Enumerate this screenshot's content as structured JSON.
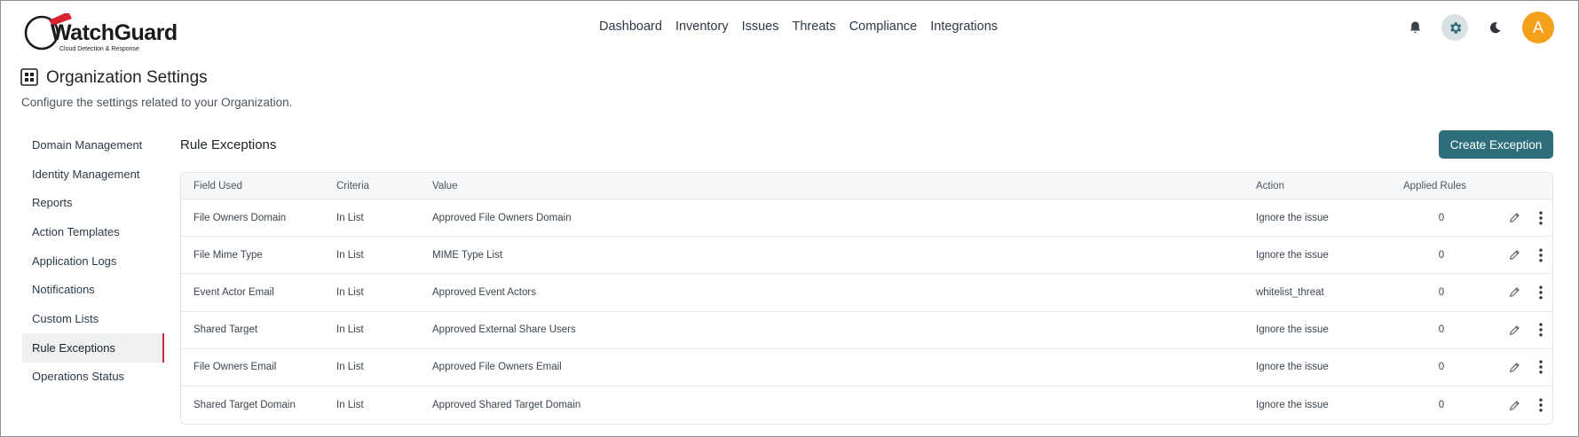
{
  "brand": {
    "name": "WatchGuard",
    "tagline": "Cloud Detection & Response"
  },
  "nav": {
    "items": [
      "Dashboard",
      "Inventory",
      "Issues",
      "Threats",
      "Compliance",
      "Integrations"
    ]
  },
  "header_icons": {
    "notifications": "bell-icon",
    "settings": "gear-icon",
    "theme": "moon-icon",
    "avatar_letter": "A",
    "avatar_color": "#f5a01a"
  },
  "page": {
    "title": "Organization Settings",
    "subtitle": "Configure the settings related to your Organization."
  },
  "sidebar": {
    "items": [
      {
        "label": "Domain Management"
      },
      {
        "label": "Identity Management"
      },
      {
        "label": "Reports"
      },
      {
        "label": "Action Templates"
      },
      {
        "label": "Application Logs"
      },
      {
        "label": "Notifications"
      },
      {
        "label": "Custom Lists"
      },
      {
        "label": "Rule Exceptions",
        "active": true
      },
      {
        "label": "Operations Status"
      }
    ]
  },
  "main": {
    "section_title": "Rule Exceptions",
    "create_label": "Create Exception",
    "accent_color": "#2e6e7a",
    "columns": {
      "field": "Field Used",
      "criteria": "Criteria",
      "value": "Value",
      "action": "Action",
      "applied": "Applied Rules"
    },
    "rows": [
      {
        "field": "File Owners Domain",
        "criteria": "In List",
        "value": "Approved File Owners Domain",
        "action": "Ignore the issue",
        "applied": "0"
      },
      {
        "field": "File Mime Type",
        "criteria": "In List",
        "value": "MIME Type List",
        "action": "Ignore the issue",
        "applied": "0"
      },
      {
        "field": "Event Actor Email",
        "criteria": "In List",
        "value": "Approved Event Actors",
        "action": "whitelist_threat",
        "applied": "0"
      },
      {
        "field": "Shared Target",
        "criteria": "In List",
        "value": "Approved External Share Users",
        "action": "Ignore the issue",
        "applied": "0"
      },
      {
        "field": "File Owners Email",
        "criteria": "In List",
        "value": "Approved File Owners Email",
        "action": "Ignore the issue",
        "applied": "0"
      },
      {
        "field": "Shared Target Domain",
        "criteria": "In List",
        "value": "Approved Shared Target Domain",
        "action": "Ignore the issue",
        "applied": "0"
      }
    ]
  }
}
